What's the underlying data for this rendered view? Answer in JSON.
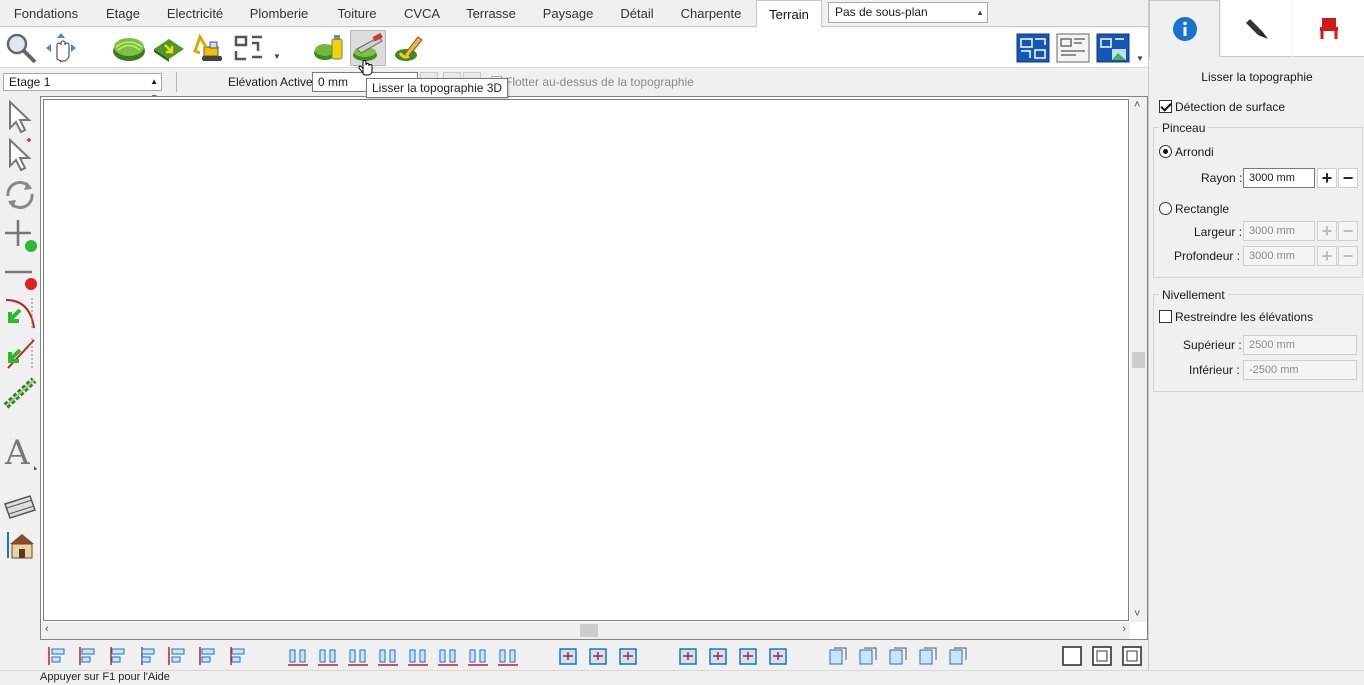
{
  "tabs": [
    {
      "label": "Fondations",
      "active": false
    },
    {
      "label": "Etage",
      "active": false
    },
    {
      "label": "Electricité",
      "active": false
    },
    {
      "label": "Plomberie",
      "active": false
    },
    {
      "label": "Toiture",
      "active": false
    },
    {
      "label": "CVCA",
      "active": false
    },
    {
      "label": "Terrasse",
      "active": false
    },
    {
      "label": "Paysage",
      "active": false
    },
    {
      "label": "Détail",
      "active": false
    },
    {
      "label": "Charpente",
      "active": false
    },
    {
      "label": "Terrain",
      "active": true
    }
  ],
  "subplan_select": {
    "value": "Pas de sous-plan"
  },
  "floor_select": {
    "value": "Etage 1"
  },
  "elevation": {
    "label": "Elévation Active:",
    "value": "0 mm"
  },
  "float_option": {
    "label": "Flotter au-dessus de la topographie",
    "checked": false
  },
  "tooltip": "Lisser la topographie 3D",
  "toolbar_icons": [
    "zoom-icon",
    "pan-icon",
    "terrain-icon",
    "terrain-arrow-icon",
    "excavator-icon",
    "path-icon",
    "terrain-paint-icon",
    "smooth-terrain-icon",
    "terrain-brush-icon",
    "view-plan-icon",
    "view-elevation-icon",
    "view-3d-icon"
  ],
  "right_panel": {
    "title": "Lisser la topographie",
    "surface_detection": {
      "label": "Détection de surface",
      "checked": true
    },
    "brush": {
      "group_label": "Pinceau",
      "round": {
        "label": "Arrondi",
        "checked": true
      },
      "radius": {
        "label": "Rayon :",
        "value": "3000 mm"
      },
      "rectangle": {
        "label": "Rectangle",
        "checked": false
      },
      "width": {
        "label": "Largeur :",
        "value": "3000 mm"
      },
      "depth": {
        "label": "Profondeur :",
        "value": "3000 mm"
      }
    },
    "leveling": {
      "group_label": "Nivellement",
      "restrict": {
        "label": "Restreindre les élévations",
        "checked": false
      },
      "upper": {
        "label": "Supérieur :",
        "value": "2500 mm"
      },
      "lower": {
        "label": "Inférieur :",
        "value": "-2500 mm"
      }
    }
  },
  "status_text": "Appuyer sur F1 pour l'Aide",
  "colors": {
    "accent_blue": "#1a73c8",
    "terrain_green": "#4caf50",
    "marker_red": "#e02020"
  }
}
